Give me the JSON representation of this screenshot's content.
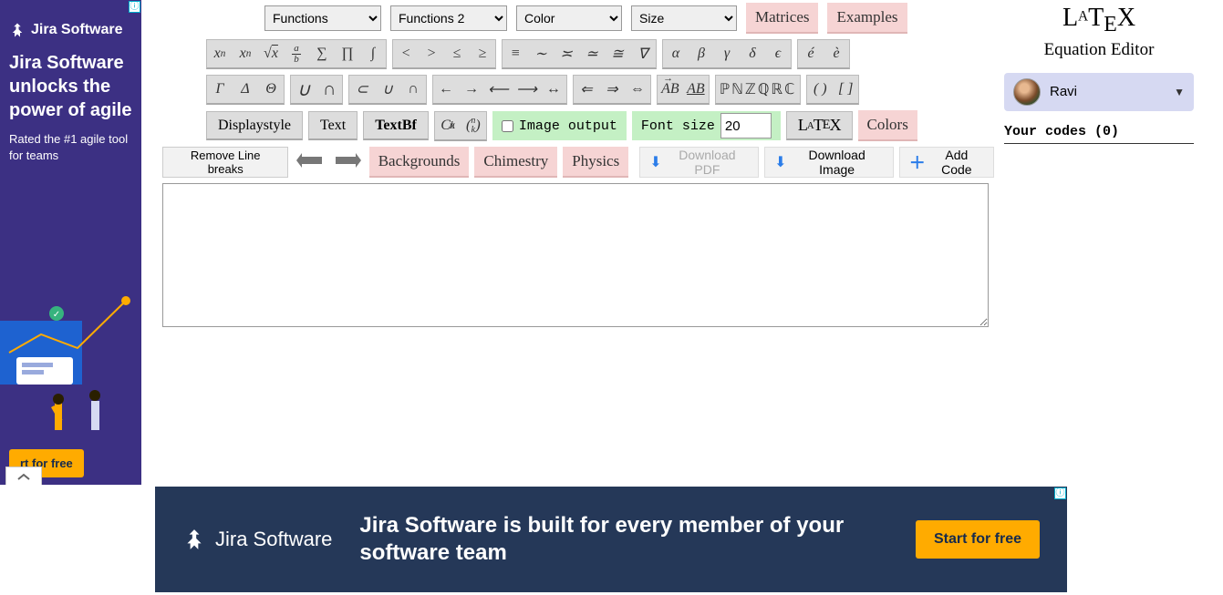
{
  "brand": {
    "logo_html": "LᴬTᴇX",
    "subtitle": "Equation Editor"
  },
  "user": {
    "name": "Ravi"
  },
  "codes_header": "Your codes (0)",
  "top_selects": {
    "functions": "Functions",
    "functions2": "Functions 2",
    "color": "Color",
    "size": "Size"
  },
  "top_buttons": {
    "matrices": "Matrices",
    "examples": "Examples"
  },
  "sym_row1": {
    "g1": [
      "xⁿ",
      "xₙ",
      "√x",
      "FRAC_ab",
      "∑",
      "∏",
      "∫"
    ],
    "g2": [
      "<",
      ">",
      "≤",
      "≥"
    ],
    "g3": [
      "≡",
      "∼",
      "≍",
      "≃",
      "≅",
      "∇"
    ],
    "g4": [
      "α",
      "β",
      "γ",
      "δ",
      "ϵ"
    ],
    "g5": [
      "é",
      "è"
    ]
  },
  "sym_row2": {
    "g1": [
      "Γ",
      "Δ",
      "Θ"
    ],
    "g2": [
      "∪",
      "∩"
    ],
    "g3": [
      "⊂",
      "∪",
      "∩"
    ],
    "g4": [
      "←",
      "→",
      "⟵",
      "⟶",
      "↔"
    ],
    "g5": [
      "⇐",
      "⇒",
      "⇔"
    ],
    "g6": [
      "VEC_AB",
      "UND_AB"
    ],
    "g7": "ℙℕℤℚℝℂ",
    "g8": [
      "( )",
      "[ ]"
    ]
  },
  "row3": {
    "displaystyle": "Displaystyle",
    "text": "Text",
    "textbf": "TextBf",
    "cnk": "Cⁿₖ",
    "binom": "(ⁿₖ)",
    "image_output": "Image output",
    "font_size_label": "Font size",
    "font_size_value": "20",
    "latex_glyph": "LᴬTᴇX",
    "colors": "Colors"
  },
  "actions": {
    "remove_breaks": "Remove Line breaks",
    "backgrounds": "Backgrounds",
    "chemistry": "Chimestry",
    "physics": "Physics",
    "download_pdf": "Download PDF",
    "download_image": "Download Image",
    "add_code": "Add Code"
  },
  "ads": {
    "side": {
      "brand": "Jira Software",
      "headline": "Jira Software unlocks the power of agile",
      "sub": "Rated the #1 agile tool for teams",
      "cta": "rt for free"
    },
    "bottom": {
      "brand": "Jira Software",
      "text": "Jira Software is built for every member of your software team",
      "cta": "Start for free"
    }
  }
}
